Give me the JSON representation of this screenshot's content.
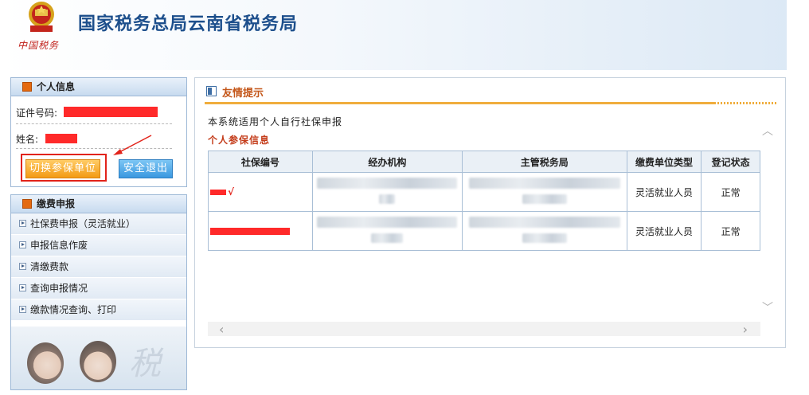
{
  "header": {
    "title": "国家税务总局云南省税务局",
    "brand": "中国税务"
  },
  "sidebar": {
    "info_panel": {
      "title": "个人信息",
      "id_label": "证件号码:",
      "name_label": "姓名:",
      "switch_button": "切换参保单位",
      "logout_button": "安全退出"
    },
    "menu_panel": {
      "title": "缴费申报",
      "items": [
        "社保费申报（灵活就业）",
        "申报信息作废",
        "清缴费款",
        "查询申报情况",
        "缴款情况查询、打印"
      ],
      "art_text": "税"
    }
  },
  "main": {
    "section_title": "友情提示",
    "notice": "本系统适用个人自行社保申报",
    "subtitle": "个人参保信息",
    "table": {
      "headers": [
        "社保编号",
        "经办机构",
        "主管税务局",
        "缴费单位类型",
        "登记状态"
      ],
      "rows": [
        {
          "check": "√",
          "unit_type": "灵活就业人员",
          "status": "正常"
        },
        {
          "check": "",
          "unit_type": "灵活就业人员",
          "status": "正常"
        }
      ]
    }
  },
  "colors": {
    "redaction": "#ff2a2a",
    "accent_orange": "#f0ad3d",
    "title_blue": "#1d4f8c"
  }
}
